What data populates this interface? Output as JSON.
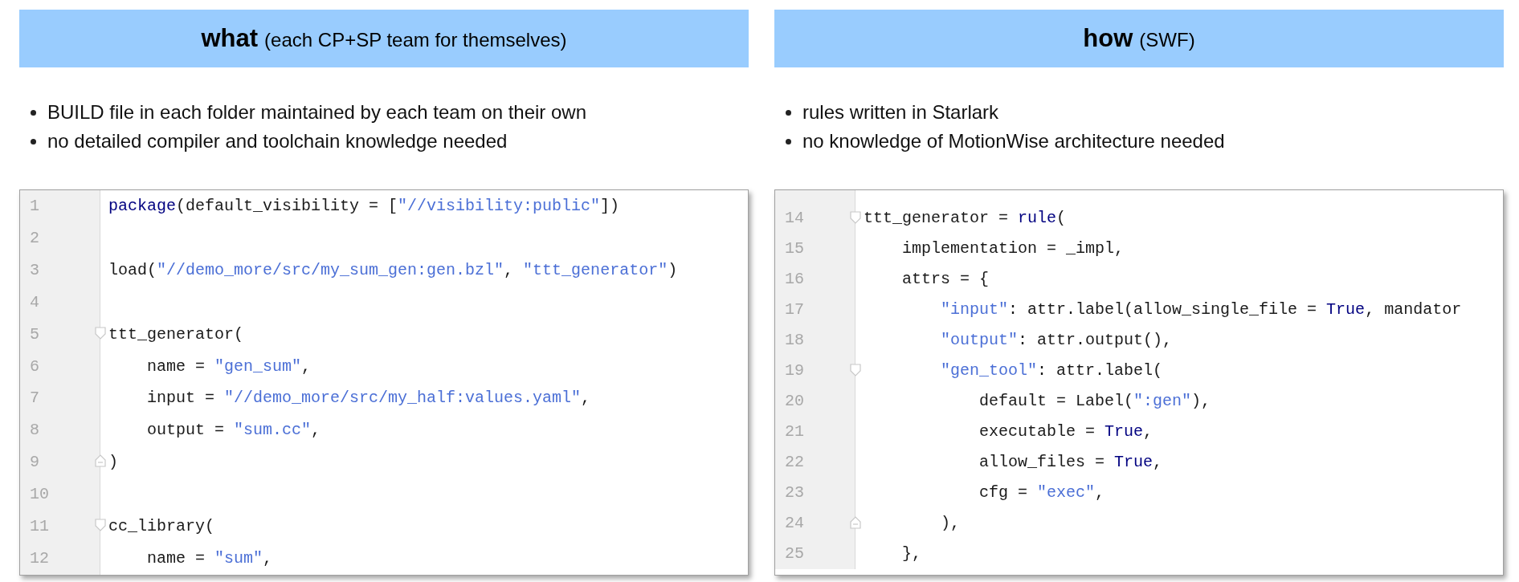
{
  "columns": [
    {
      "heading": {
        "title": "what",
        "subtitle": "(each CP+SP team for themselves)"
      },
      "bullets": [
        "BUILD file in each folder maintained by each team on their own",
        "no detailed compiler and toolchain knowledge needed"
      ],
      "editor": {
        "cut_top": false,
        "lines": [
          {
            "number": "1",
            "tokens": [
              {
                "kind": "keyword",
                "text": "package"
              },
              {
                "kind": "plain",
                "text": "(default_visibility = ["
              },
              {
                "kind": "string",
                "text": "\"//visibility:public\""
              },
              {
                "kind": "plain",
                "text": "])"
              }
            ]
          },
          {
            "number": "2"
          },
          {
            "number": "3",
            "tokens": [
              {
                "kind": "plain",
                "text": "load("
              },
              {
                "kind": "string",
                "text": "\"//demo_more/src/my_sum_gen:gen.bzl\""
              },
              {
                "kind": "plain",
                "text": ", "
              },
              {
                "kind": "string",
                "text": "\"ttt_generator\""
              },
              {
                "kind": "plain",
                "text": ")"
              }
            ]
          },
          {
            "number": "4"
          },
          {
            "number": "5",
            "fold_start": true,
            "tokens": [
              {
                "kind": "plain",
                "text": "ttt_generator("
              }
            ]
          },
          {
            "number": "6",
            "tokens": [
              {
                "kind": "plain",
                "text": "    name = "
              },
              {
                "kind": "string",
                "text": "\"gen_sum\""
              },
              {
                "kind": "plain",
                "text": ","
              }
            ]
          },
          {
            "number": "7",
            "tokens": [
              {
                "kind": "plain",
                "text": "    input = "
              },
              {
                "kind": "string",
                "text": "\"//demo_more/src/my_half:values.yaml\""
              },
              {
                "kind": "plain",
                "text": ","
              }
            ]
          },
          {
            "number": "8",
            "tokens": [
              {
                "kind": "plain",
                "text": "    output = "
              },
              {
                "kind": "string",
                "text": "\"sum.cc\""
              },
              {
                "kind": "plain",
                "text": ","
              }
            ]
          },
          {
            "number": "9",
            "fold_end": true,
            "tokens": [
              {
                "kind": "plain",
                "text": ")"
              }
            ]
          },
          {
            "number": "10"
          },
          {
            "number": "11",
            "fold_start": true,
            "tokens": [
              {
                "kind": "plain",
                "text": "cc_library("
              }
            ]
          },
          {
            "number": "12",
            "tokens": [
              {
                "kind": "plain",
                "text": "    name = "
              },
              {
                "kind": "string",
                "text": "\"sum\""
              },
              {
                "kind": "plain",
                "text": ","
              }
            ]
          }
        ]
      }
    },
    {
      "heading": {
        "title": "how",
        "subtitle": "(SWF)"
      },
      "bullets": [
        "rules written in Starlark",
        "no knowledge of MotionWise architecture needed"
      ],
      "editor": {
        "cut_top": true,
        "lines": [
          {
            "number": "14",
            "fold_start": true,
            "tokens": [
              {
                "kind": "plain",
                "text": "ttt_generator = "
              },
              {
                "kind": "keyword",
                "text": "rule"
              },
              {
                "kind": "plain",
                "text": "("
              }
            ]
          },
          {
            "number": "15",
            "tokens": [
              {
                "kind": "plain",
                "text": "    implementation = _impl,"
              }
            ]
          },
          {
            "number": "16",
            "tokens": [
              {
                "kind": "plain",
                "text": "    attrs = {"
              }
            ]
          },
          {
            "number": "17",
            "tokens": [
              {
                "kind": "string",
                "text": "        \"input\""
              },
              {
                "kind": "plain",
                "text": ": attr.label(allow_single_file = "
              },
              {
                "kind": "keyword",
                "text": "True"
              },
              {
                "kind": "plain",
                "text": ", mandator"
              }
            ]
          },
          {
            "number": "18",
            "tokens": [
              {
                "kind": "string",
                "text": "        \"output\""
              },
              {
                "kind": "plain",
                "text": ": attr.output(),"
              }
            ]
          },
          {
            "number": "19",
            "fold_start": true,
            "tokens": [
              {
                "kind": "string",
                "text": "        \"gen_tool\""
              },
              {
                "kind": "plain",
                "text": ": attr.label("
              }
            ]
          },
          {
            "number": "20",
            "tokens": [
              {
                "kind": "plain",
                "text": "            default = Label("
              },
              {
                "kind": "string",
                "text": "\":gen\""
              },
              {
                "kind": "plain",
                "text": "),"
              }
            ]
          },
          {
            "number": "21",
            "tokens": [
              {
                "kind": "plain",
                "text": "            executable = "
              },
              {
                "kind": "keyword",
                "text": "True"
              },
              {
                "kind": "plain",
                "text": ","
              }
            ]
          },
          {
            "number": "22",
            "tokens": [
              {
                "kind": "plain",
                "text": "            allow_files = "
              },
              {
                "kind": "keyword",
                "text": "True"
              },
              {
                "kind": "plain",
                "text": ","
              }
            ]
          },
          {
            "number": "23",
            "tokens": [
              {
                "kind": "plain",
                "text": "            cfg = "
              },
              {
                "kind": "string",
                "text": "\"exec\""
              },
              {
                "kind": "plain",
                "text": ","
              }
            ]
          },
          {
            "number": "24",
            "fold_end": true,
            "tokens": [
              {
                "kind": "plain",
                "text": "        ),"
              }
            ]
          },
          {
            "number": "25",
            "tokens": [
              {
                "kind": "plain",
                "text": "    },"
              }
            ]
          }
        ]
      }
    }
  ]
}
